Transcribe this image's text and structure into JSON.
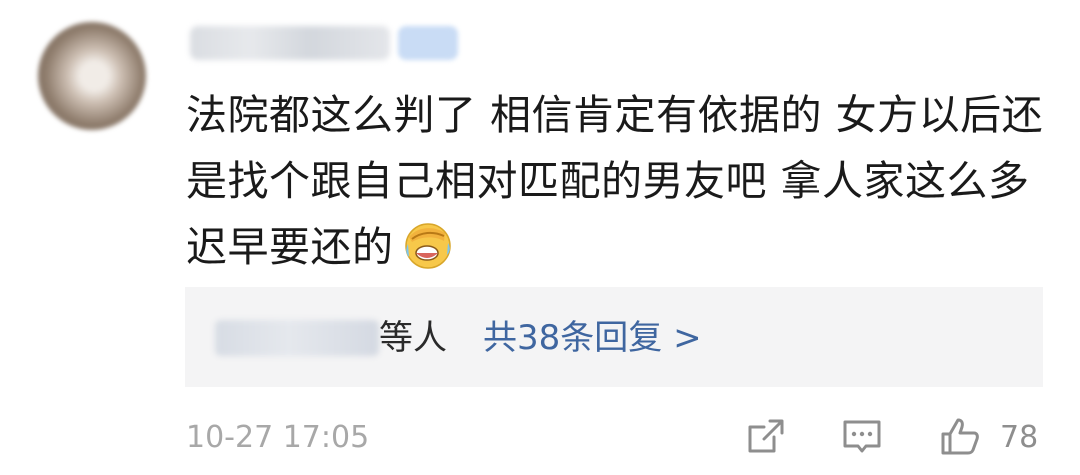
{
  "comment": {
    "text": "法院都这么判了 相信肯定有依据的 女方以后还是找个跟自己相对匹配的男友吧 拿人家这么多迟早要还的",
    "emoji": "laughing-crying-emoji"
  },
  "replies": {
    "who_suffix": "等人",
    "link_text": "共38条回复 >"
  },
  "footer": {
    "timestamp": "10-27 17:05",
    "like_count": "78",
    "icons": [
      "share-icon",
      "comment-icon",
      "like-icon"
    ]
  },
  "colors": {
    "link": "#3f66a0",
    "text": "#1a1a1a",
    "meta": "#a8a8a8",
    "reply_bg": "#f4f4f5"
  }
}
